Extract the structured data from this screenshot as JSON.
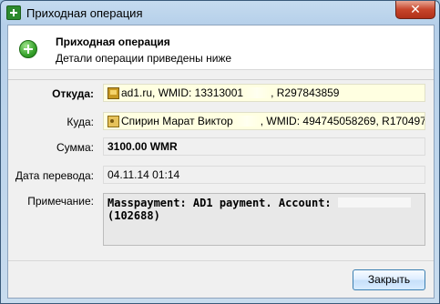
{
  "window": {
    "title": "Приходная операция",
    "close_glyph": "✕"
  },
  "header": {
    "title": "Приходная операция",
    "subtitle": "Детали операции приведены ниже"
  },
  "fields": {
    "from": {
      "label": "Откуда:",
      "value_a": "ad1.ru, WMID: 13313001",
      "value_b": ", R297843859"
    },
    "to": {
      "label": "Куда:",
      "value_a": "Спирин Марат Виктор",
      "value_b": ", WMID: 494745058269, R170497"
    },
    "amount": {
      "label": "Сумма:",
      "value": "3100.00 WMR"
    },
    "date": {
      "label": "Дата перевода:",
      "value": "04.11.14 01:14"
    },
    "note": {
      "label": "Примечание:",
      "value_a": "Masspayment: AD1 payment. Account:",
      "value_b": "(102688)"
    }
  },
  "footer": {
    "close_label": "Закрыть"
  },
  "icons": {
    "window": "add-icon",
    "header": "plus-circle-icon",
    "from": "site-icon",
    "to": "person-icon"
  }
}
